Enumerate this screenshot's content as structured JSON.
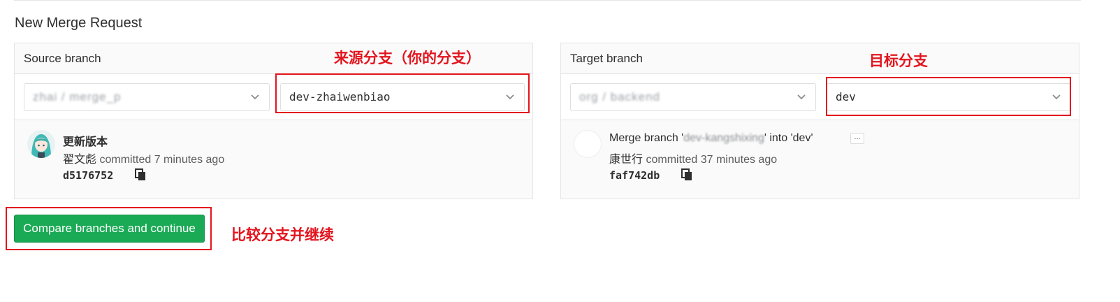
{
  "page": {
    "title": "New Merge Request"
  },
  "source": {
    "header": "Source branch",
    "project_value": "zhai / merge_p",
    "branch_value": "dev-zhaiwenbiao",
    "commit": {
      "title": "更新版本",
      "author": "翟文彪",
      "meta_suffix": " committed 7 minutes ago",
      "sha": "d5176752"
    }
  },
  "target": {
    "header": "Target branch",
    "project_value": "org / backend",
    "branch_value": "dev",
    "commit": {
      "title_prefix": "Merge branch '",
      "title_hidden": "dev-kangshixing",
      "title_suffix": "' into 'dev'",
      "ellipsis": "...",
      "author": "康世行",
      "meta_suffix": " committed 37 minutes ago",
      "sha": "faf742db"
    }
  },
  "actions": {
    "compare_label": "Compare branches and continue"
  },
  "annotations": {
    "source_note": "来源分支（你的分支）",
    "target_note": "目标分支",
    "compare_note": "比较分支并继续",
    "color": "#e3141e"
  },
  "colors": {
    "primary_button": "#1aaa55",
    "border": "#e5e5e5",
    "panel_bg": "#fafafa"
  }
}
